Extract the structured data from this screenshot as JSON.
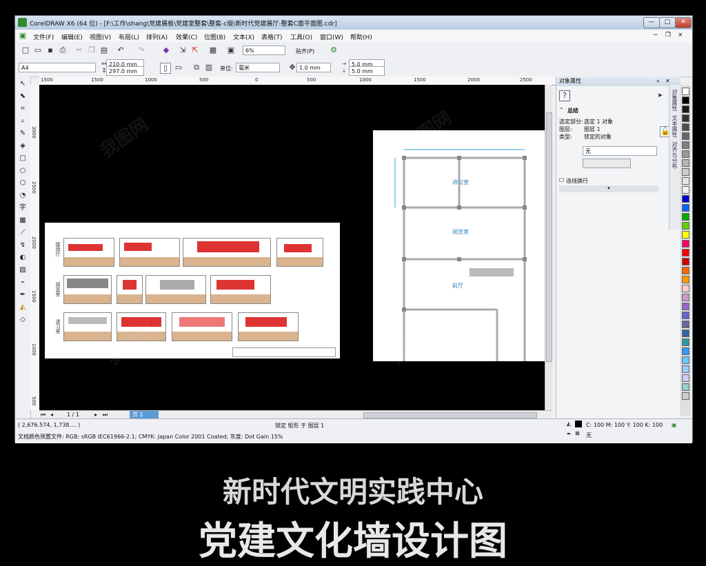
{
  "window": {
    "title": "CorelDRAW X6 (64 位) - [F:\\工作\\shang\\党建展板\\党建室整套\\整套-c版\\新时代党建展厅-整套C面平面图.cdr]",
    "buttons": {
      "minimize": "—",
      "maximize": "□",
      "close": "✕",
      "restore": "❐"
    }
  },
  "menu": [
    "文件(F)",
    "编辑(E)",
    "视图(V)",
    "布局(L)",
    "排列(A)",
    "效果(C)",
    "位图(B)",
    "文本(X)",
    "表格(T)",
    "工具(O)",
    "窗口(W)",
    "帮助(H)"
  ],
  "toolbar": {
    "zoom": "6%",
    "snap_label": "贴齐(P)"
  },
  "property_bar": {
    "page_size": "A4",
    "width": "210.0 mm",
    "height": "297.0 mm",
    "units_label": "单位:",
    "units": "毫米",
    "nudge": "1.0 mm",
    "dup_x": "5.0 mm",
    "dup_y": "5.0 mm"
  },
  "rulers": {
    "h": [
      "1500",
      "1000",
      "500",
      "0",
      "500",
      "1000",
      "1500",
      "2000",
      "2500"
    ],
    "v": [
      "3000",
      "2500",
      "2000",
      "1500",
      "1000",
      "500"
    ]
  },
  "page_nav": {
    "position": "1 / 1",
    "tab": "页 1"
  },
  "panel": {
    "title": "对象属性",
    "section": "总结",
    "rows": [
      {
        "label": "选定部分:",
        "value": "选定 1 对象"
      },
      {
        "label": "图层:",
        "value": "图层 1"
      },
      {
        "label": "类型:",
        "value": "锁定的对象"
      }
    ],
    "dropdown": "无",
    "checkbox_label": "连线换行"
  },
  "dock_tabs": [
    "对象属性",
    "文本属性",
    "对齐与分布"
  ],
  "palette_colors": [
    "#ffffff",
    "#000000",
    "#1a1a1a",
    "#333333",
    "#4d4d4d",
    "#666666",
    "#808080",
    "#999999",
    "#b3b3b3",
    "#cccccc",
    "#e6e6e6",
    "#f2f2f2",
    "#0000cc",
    "#0066ff",
    "#00aa00",
    "#66cc00",
    "#ffff00",
    "#ff0066",
    "#ff0000",
    "#cc0000",
    "#ff6600",
    "#ff9900",
    "#ffcccc",
    "#cc99cc",
    "#9966cc",
    "#6666cc",
    "#666699",
    "#336699",
    "#339999",
    "#3399ff",
    "#66ccff",
    "#99ccff",
    "#ccccff",
    "#99cccc",
    "#cccccc"
  ],
  "status": {
    "coords": "( 2,676.574, 1,738.... )",
    "info": "锁定 矩形 于 图层 1",
    "fill": "C: 100 M: 100 Y: 100 K: 100",
    "outline": "无",
    "color_profile": "文档颜色预置文件: RGB: sRGB IEC61966-2.1; CMYK: Japan Color 2001 Coated; 灰度: Dot Gain 15%"
  },
  "canvas": {
    "left_page": {
      "rows": [
        "接待厅",
        "阅览室",
        "讲习室"
      ]
    },
    "plan": {
      "rooms": [
        "讲习室",
        "阅览室",
        "前厅"
      ]
    }
  },
  "overlay": {
    "line1": "新时代文明实践中心",
    "line2": "党建文化墙设计图"
  },
  "watermark": "我图网"
}
